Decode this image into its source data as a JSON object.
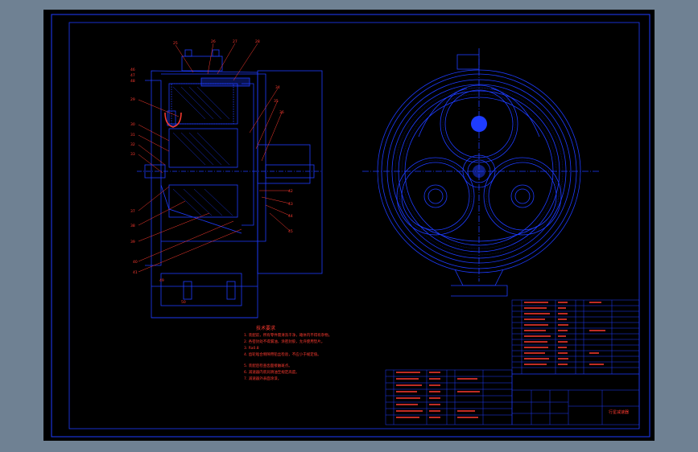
{
  "drawing": {
    "part_numbers_left": [
      "25",
      "26",
      "27",
      "28",
      "29",
      "30",
      "31",
      "32",
      "33",
      "34",
      "35",
      "36",
      "37",
      "38",
      "39",
      "40",
      "41",
      "42",
      "43",
      "44",
      "45",
      "46",
      "47",
      "48",
      "49",
      "50"
    ],
    "tech_requirements_title": "技术要求",
    "tech_requirements": [
      "1. 装配前，所有零件需清洗干净，箱体内不得有杂物。",
      "2. 各密封处不得漏油，涂密封胶，允许使用垫片。",
      "3. Ra0.8",
      "4. 齿轮啮合侧隙用铅丝检验，不应小于规定值。",
      "5. 装配后检查齿面接触斑点。",
      "6. 减速器内装润滑油至规定高度。",
      "7. 减速器外表面涂漆。"
    ],
    "drawing_title": "行星减速器",
    "colors": {
      "background": "#000000",
      "frame_outside": "#6f8193",
      "lines": "#1e3cff",
      "notes": "#ff3b30",
      "leader": "#ff3b30"
    }
  }
}
